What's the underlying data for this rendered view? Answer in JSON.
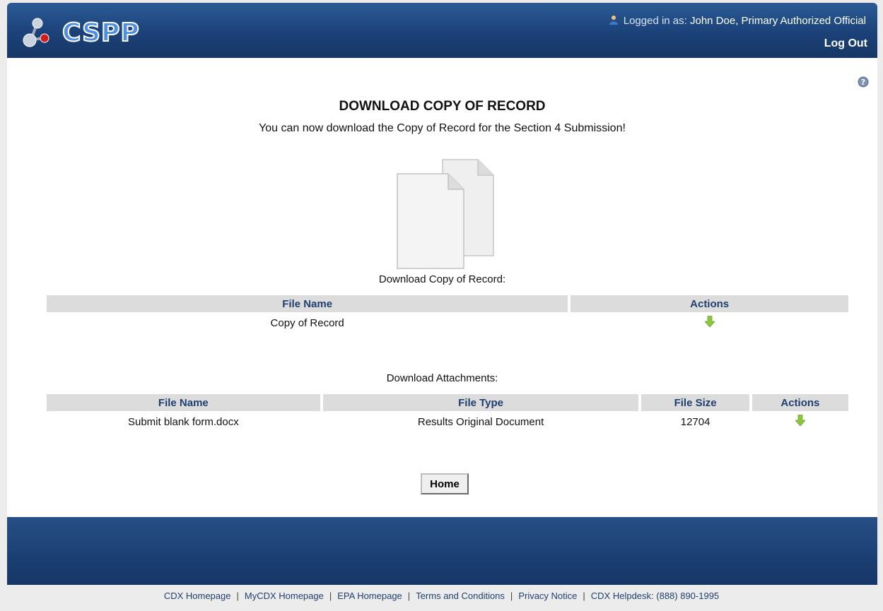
{
  "header": {
    "app_name": "CSPP",
    "logged_in_label": "Logged in as:",
    "user_name": "John Doe, Primary Authorized Official",
    "logout_label": "Log Out"
  },
  "page": {
    "title": "DOWNLOAD COPY OF RECORD",
    "subtitle": "You can now download the Copy of Record for the Section 4 Submission!",
    "copy_section_label": "Download Copy of Record:",
    "attachments_section_label": "Download Attachments:"
  },
  "copy_table": {
    "headers": [
      "File Name",
      "Actions"
    ],
    "rows": [
      {
        "file_name": "Copy of Record"
      }
    ]
  },
  "attachments_table": {
    "headers": [
      "File Name",
      "File Type",
      "File Size",
      "Actions"
    ],
    "rows": [
      {
        "file_name": "Submit blank form.docx",
        "file_type": "Results Original Document",
        "file_size": "12704"
      }
    ]
  },
  "buttons": {
    "home": "Home"
  },
  "footer": {
    "links": [
      "CDX Homepage",
      "MyCDX Homepage",
      "EPA Homepage",
      "Terms and Conditions",
      "Privacy Notice"
    ],
    "helpdesk": "CDX Helpdesk: (888) 890-1995"
  },
  "colors": {
    "header_bg": "#1b4178",
    "table_header_bg": "#dcdcdc",
    "table_header_text": "#1f3f6e",
    "download_arrow": "#8cc63f"
  },
  "icons": {
    "user": "user-icon",
    "help": "help-icon",
    "document": "document-icon",
    "download": "download-arrow-icon"
  }
}
